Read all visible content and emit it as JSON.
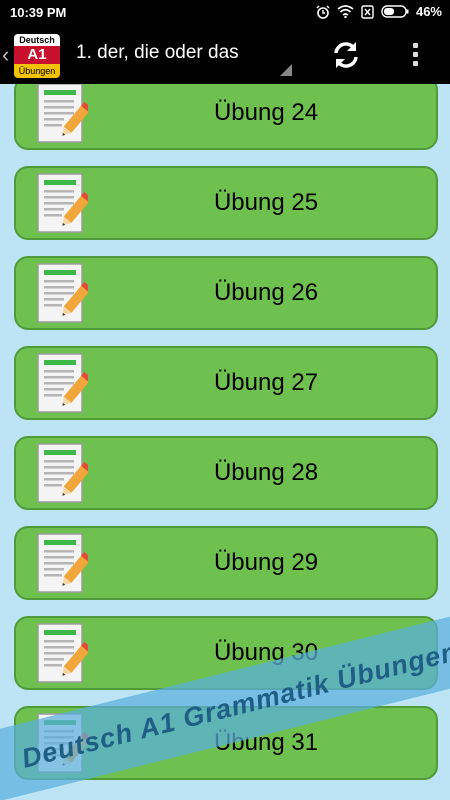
{
  "status_bar": {
    "time": "10:39 PM",
    "battery": "46%",
    "icons": [
      "alarm-icon",
      "wifi-icon",
      "no-sim-icon",
      "battery-icon"
    ]
  },
  "action_bar": {
    "logo": {
      "line1": "Deutsch",
      "line2": "A1",
      "line3": "Übungen"
    },
    "title": "1. der, die oder das",
    "icons": [
      "back-chevron-icon",
      "dropdown-triangle-icon",
      "refresh-icon",
      "overflow-menu-icon"
    ]
  },
  "list": {
    "items": [
      {
        "label": "Übung 24"
      },
      {
        "label": "Übung 25"
      },
      {
        "label": "Übung 26"
      },
      {
        "label": "Übung 27"
      },
      {
        "label": "Übung 28"
      },
      {
        "label": "Übung 29"
      },
      {
        "label": "Übung 30"
      },
      {
        "label": "Übung 31"
      }
    ],
    "item_icon": "exercise-document-icon"
  },
  "watermark": {
    "text": "Deutsch A1 Grammatik Übungen"
  },
  "colors": {
    "item_background": "#6ec14f",
    "item_border": "#4f9a3a",
    "list_background": "#bde4f4",
    "bar_background": "#000000",
    "banner": "#5aafdc"
  }
}
